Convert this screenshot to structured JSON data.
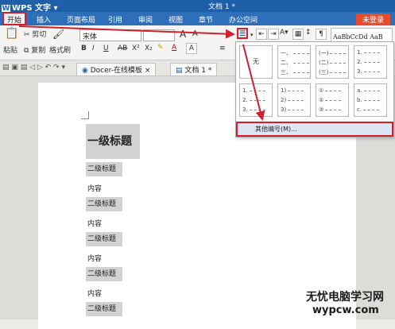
{
  "app": {
    "name": "WPS 文字",
    "doc_title": "文档 1 *"
  },
  "menu": {
    "tabs": [
      "开始",
      "插入",
      "页面布局",
      "引用",
      "审阅",
      "视图",
      "章节",
      "办公空间"
    ],
    "login": "未登录"
  },
  "ribbon": {
    "paste": "粘贴",
    "cut": "剪切",
    "copy": "复制",
    "format_painter": "格式刷",
    "font_name": "宋体",
    "style_preview": "AaBbCcDd AaB"
  },
  "tabs": {
    "docer": "Docer-在线模板",
    "doc": "文档 1 *"
  },
  "numbering": {
    "none": "无",
    "styles": [
      [
        "一、",
        "二、",
        "三、"
      ],
      [
        "(一)",
        "(二)",
        "(三)"
      ],
      [
        "1.",
        "2.",
        "3."
      ],
      [
        "1.",
        "2.",
        "3."
      ],
      [
        "1)",
        "2)",
        "3)"
      ],
      [
        "①",
        "②",
        "③"
      ],
      [
        "a.",
        "b.",
        "c."
      ]
    ],
    "more": "其他编号(M)..."
  },
  "document": {
    "heading1": "一级标题",
    "heading2": "二级标题",
    "content": "内容"
  },
  "watermark": {
    "line1": "无忧电脑学习网",
    "line2": "wypcw.com"
  },
  "colors": {
    "accent": "#1d5fa9",
    "highlight": "#d02030"
  }
}
